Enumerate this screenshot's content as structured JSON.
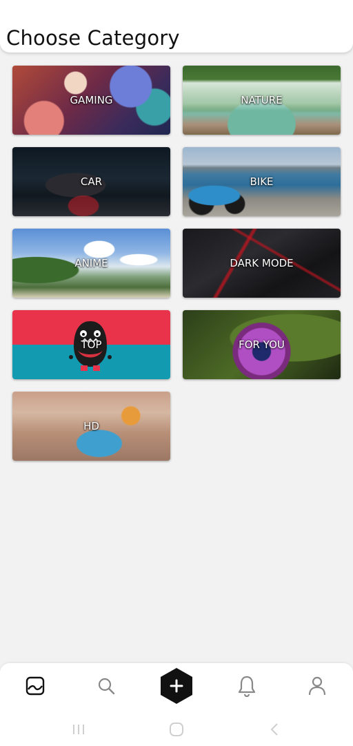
{
  "header": {
    "title": "Choose Category"
  },
  "categories": [
    {
      "label": "GAMING"
    },
    {
      "label": "NATURE"
    },
    {
      "label": "CAR"
    },
    {
      "label": "BIKE"
    },
    {
      "label": "ANIME"
    },
    {
      "label": "DARK MODE"
    },
    {
      "label": "TOP"
    },
    {
      "label": "FOR YOU"
    },
    {
      "label": "HD"
    }
  ],
  "bottom_nav": {
    "items": [
      {
        "icon": "wallpaper-icon",
        "active": true
      },
      {
        "icon": "search-icon",
        "active": false
      },
      {
        "icon": "add-icon",
        "active": false
      },
      {
        "icon": "bell-icon",
        "active": false
      },
      {
        "icon": "profile-icon",
        "active": false
      }
    ]
  },
  "system_nav": {
    "items": [
      {
        "icon": "recent-apps-icon"
      },
      {
        "icon": "home-icon"
      },
      {
        "icon": "back-icon"
      }
    ]
  },
  "colors": {
    "background": "#f2f2f2",
    "accent": "#111111",
    "icon": "#888888"
  }
}
